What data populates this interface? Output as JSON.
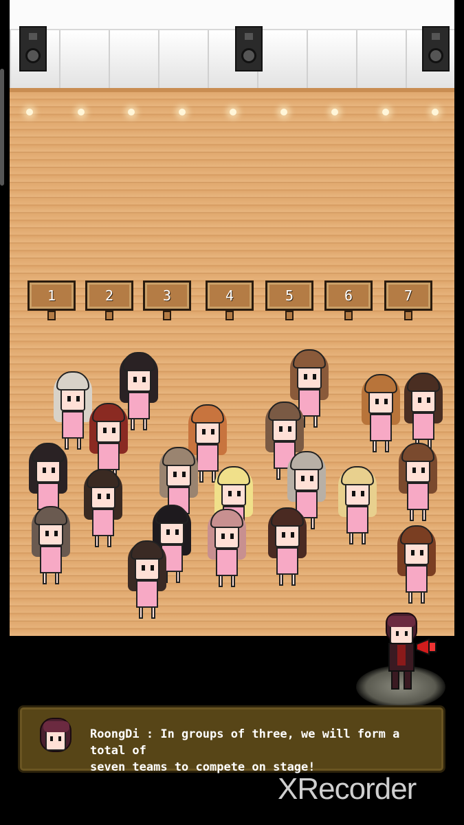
{
  "stage": {
    "team_signs": [
      "1",
      "2",
      "3",
      "4",
      "5",
      "6",
      "7"
    ]
  },
  "dialog": {
    "speaker": "RoongDi",
    "line1": "RoongDi : In groups of three, we will form a total of",
    "line2": "seven teams to compete on stage!"
  },
  "watermark": {
    "text": "XRecorder"
  },
  "icons": {
    "speaker": "speaker-icon",
    "megaphone": "megaphone-icon"
  },
  "colors": {
    "floor": "#dca36a",
    "dialog_bg": "#574517",
    "shirt": "#f7a9c5"
  }
}
